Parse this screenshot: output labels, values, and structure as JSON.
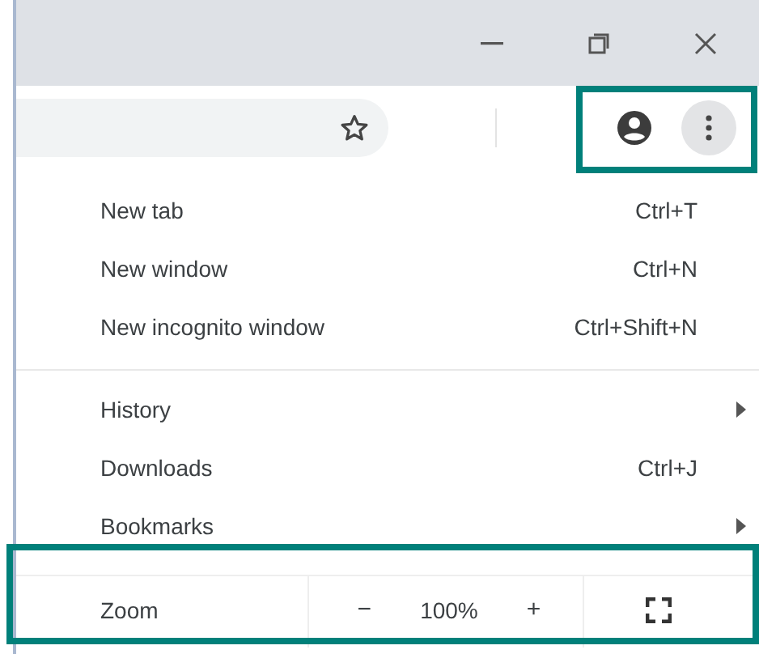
{
  "toolbar": {
    "highlighted": true
  },
  "menu_groups": [
    {
      "items": [
        {
          "kind": "shortcut",
          "label": "New tab",
          "shortcut": "Ctrl+T"
        },
        {
          "kind": "shortcut",
          "label": "New window",
          "shortcut": "Ctrl+N"
        },
        {
          "kind": "shortcut",
          "label": "New incognito window",
          "shortcut": "Ctrl+Shift+N"
        }
      ]
    },
    {
      "items": [
        {
          "kind": "submenu",
          "label": "History"
        },
        {
          "kind": "shortcut",
          "label": "Downloads",
          "shortcut": "Ctrl+J"
        },
        {
          "kind": "submenu",
          "label": "Bookmarks"
        }
      ]
    }
  ],
  "zoom": {
    "label": "Zoom",
    "minus": "−",
    "value": "100%",
    "plus": "+",
    "highlighted": true
  }
}
